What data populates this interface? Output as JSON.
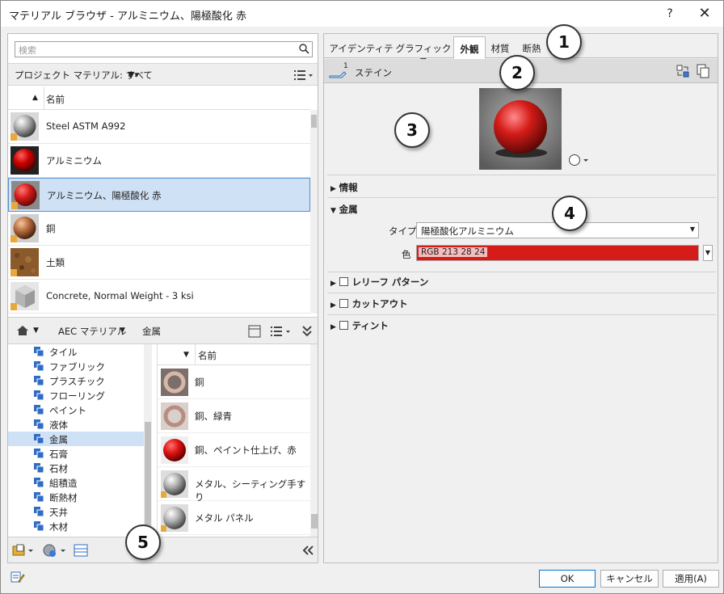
{
  "window": {
    "title": "マテリアル ブラウザ - アルミニウム、陽極酸化 赤",
    "help_label": "?",
    "close_label": "✕"
  },
  "left": {
    "search_placeholder": "検索",
    "project_label": "プロジェクト マテリアル: すべて",
    "column_name": "名前",
    "materials": [
      {
        "name": "Steel ASTM A992"
      },
      {
        "name": "アルミニウム"
      },
      {
        "name": "アルミニウム、陽極酸化 赤"
      },
      {
        "name": "銅"
      },
      {
        "name": "土類"
      },
      {
        "name": "Concrete, Normal Weight - 3 ksi"
      }
    ],
    "breadcrumb": [
      "AEC マテリアル",
      "金属"
    ],
    "tree": [
      "タイル",
      "ファブリック",
      "プラスチック",
      "フローリング",
      "ペイント",
      "液体",
      "金属",
      "石膏",
      "石材",
      "組積造",
      "断熱材",
      "天井",
      "木材"
    ],
    "library_column": "名前",
    "library_items": [
      {
        "name": "銅"
      },
      {
        "name": "銅、緑青"
      },
      {
        "name": "銅、ペイント仕上げ、赤"
      },
      {
        "name": "メタル、シーティング手すり"
      },
      {
        "name": "メタル パネル"
      }
    ]
  },
  "right": {
    "tabs": [
      "アイデンティティ",
      "グラフィックス",
      "外観",
      "材質",
      "断熱"
    ],
    "active_tab": "外観",
    "asset_count": "1",
    "asset_name": "ステイン",
    "sections": {
      "info": "情報",
      "metal": "金属",
      "relief": "レリーフ パターン",
      "cutout": "カットアウト",
      "tint": "ティント"
    },
    "type_label": "タイプ",
    "type_value": "陽極酸化アルミニウム",
    "color_label": "色",
    "color_value": "RGB 213 28 24",
    "color_hex": "#d51c18"
  },
  "buttons": {
    "ok": "OK",
    "cancel": "キャンセル",
    "apply": "適用(A)"
  },
  "callouts": [
    "1",
    "2",
    "3",
    "4",
    "5"
  ]
}
